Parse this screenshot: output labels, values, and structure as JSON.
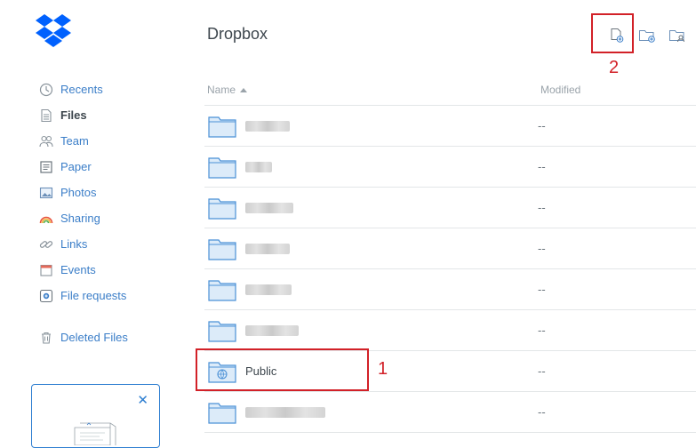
{
  "title": "Dropbox",
  "sidebar": {
    "items": [
      {
        "label": "Recents"
      },
      {
        "label": "Files"
      },
      {
        "label": "Team"
      },
      {
        "label": "Paper"
      },
      {
        "label": "Photos"
      },
      {
        "label": "Sharing"
      },
      {
        "label": "Links"
      },
      {
        "label": "Events"
      },
      {
        "label": "File requests"
      },
      {
        "label": "Deleted Files"
      }
    ],
    "promo_close": "✕"
  },
  "table": {
    "col_name": "Name",
    "col_modified": "Modified",
    "rows": [
      {
        "name": "",
        "modified": "--"
      },
      {
        "name": "",
        "modified": "--"
      },
      {
        "name": "",
        "modified": "--"
      },
      {
        "name": "",
        "modified": "--"
      },
      {
        "name": "",
        "modified": "--"
      },
      {
        "name": "",
        "modified": "--"
      },
      {
        "name": "Public",
        "modified": "--"
      },
      {
        "name": "",
        "modified": "--"
      }
    ]
  },
  "annotations": {
    "one": "1",
    "two": "2"
  },
  "colors": {
    "accent": "#3b7ec8",
    "annotation": "#d22128",
    "folder": "#4a90d6"
  }
}
